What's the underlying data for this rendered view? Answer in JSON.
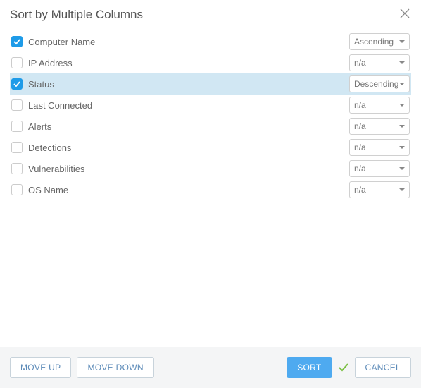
{
  "header": {
    "title": "Sort by Multiple Columns"
  },
  "columns": [
    {
      "label": "Computer Name",
      "checked": true,
      "order": "Ascending",
      "selected": false
    },
    {
      "label": "IP Address",
      "checked": false,
      "order": "n/a",
      "selected": false
    },
    {
      "label": "Status",
      "checked": true,
      "order": "Descending",
      "selected": true
    },
    {
      "label": "Last Connected",
      "checked": false,
      "order": "n/a",
      "selected": false
    },
    {
      "label": "Alerts",
      "checked": false,
      "order": "n/a",
      "selected": false
    },
    {
      "label": "Detections",
      "checked": false,
      "order": "n/a",
      "selected": false
    },
    {
      "label": "Vulnerabilities",
      "checked": false,
      "order": "n/a",
      "selected": false
    },
    {
      "label": "OS Name",
      "checked": false,
      "order": "n/a",
      "selected": false
    }
  ],
  "buttons": {
    "move_up": "MOVE UP",
    "move_down": "MOVE DOWN",
    "sort": "SORT",
    "cancel": "CANCEL"
  }
}
